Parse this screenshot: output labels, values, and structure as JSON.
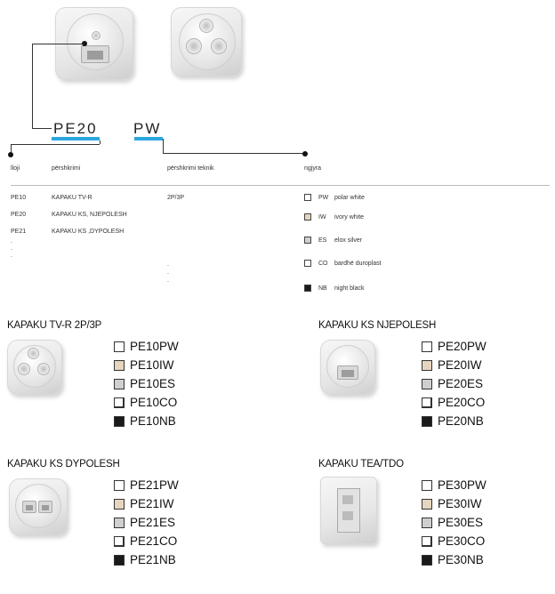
{
  "header": {
    "code1": "PE20",
    "code2": "PW"
  },
  "table": {
    "headers": [
      "lloji",
      "përshkrimi",
      "përshkrimi teknik",
      "ngjyra"
    ],
    "rows": [
      {
        "code": "PE10",
        "desc": "KAPAKU TV-R",
        "tech": "2P/3P"
      },
      {
        "code": "PE20",
        "desc": "KAPAKU KS, NJEPOLESH",
        "tech": ""
      },
      {
        "code": "PE21",
        "desc": "KAPAKU KS ,DYPOLESH",
        "tech": ""
      }
    ],
    "ellipsis": "."
  },
  "colors": [
    {
      "code": "PW",
      "name": "polar white",
      "hex": "#ffffff"
    },
    {
      "code": "IW",
      "name": "ivory white",
      "hex": "#e6d5bf"
    },
    {
      "code": "ES",
      "name": "elox silver",
      "hex": "#cfcfcf"
    },
    {
      "code": "CO",
      "name": "bardhë duroplast",
      "hex": "#ffffff"
    },
    {
      "code": "NB",
      "name": "night black",
      "hex": "#1a1a1a"
    }
  ],
  "sections": [
    {
      "title": "KAPAKU TV-R 2P/3P",
      "items": [
        "PE10PW",
        "PE10IW",
        "PE10ES",
        "PE10CO",
        "PE10NB"
      ]
    },
    {
      "title": "KAPAKU KS NJEPOLESH",
      "items": [
        "PE20PW",
        "PE20IW",
        "PE20ES",
        "PE20CO",
        "PE20NB"
      ]
    },
    {
      "title": "KAPAKU KS DYPOLESH",
      "items": [
        "PE21PW",
        "PE21IW",
        "PE21ES",
        "PE21CO",
        "PE21NB"
      ]
    },
    {
      "title": "KAPAKU TEA/TDO",
      "items": [
        "PE30PW",
        "PE30IW",
        "PE30ES",
        "PE30CO",
        "PE30NB"
      ]
    }
  ]
}
